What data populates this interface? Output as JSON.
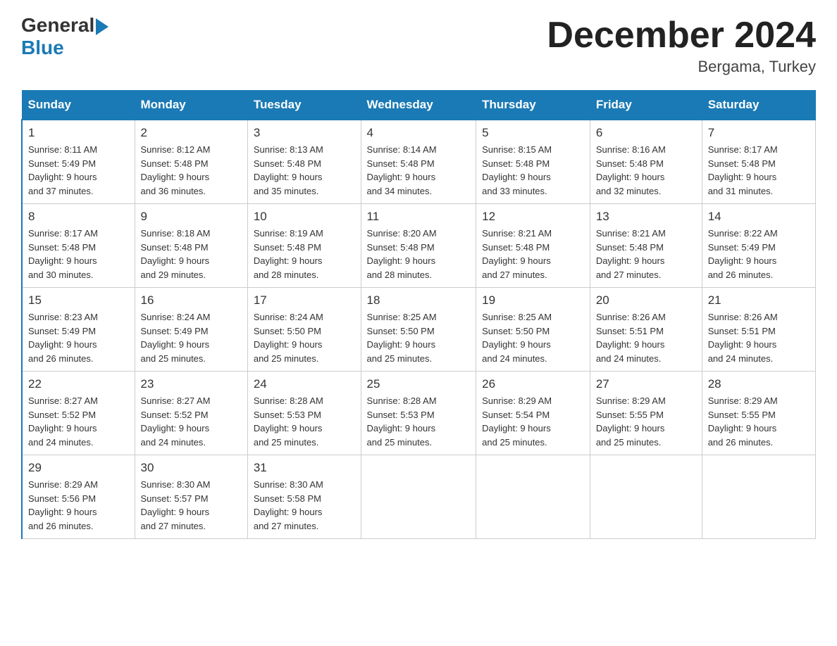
{
  "logo": {
    "general": "General",
    "blue": "Blue"
  },
  "title": "December 2024",
  "location": "Bergama, Turkey",
  "days_of_week": [
    "Sunday",
    "Monday",
    "Tuesday",
    "Wednesday",
    "Thursday",
    "Friday",
    "Saturday"
  ],
  "weeks": [
    [
      {
        "day": "1",
        "sunrise": "8:11 AM",
        "sunset": "5:49 PM",
        "daylight": "9 hours and 37 minutes."
      },
      {
        "day": "2",
        "sunrise": "8:12 AM",
        "sunset": "5:48 PM",
        "daylight": "9 hours and 36 minutes."
      },
      {
        "day": "3",
        "sunrise": "8:13 AM",
        "sunset": "5:48 PM",
        "daylight": "9 hours and 35 minutes."
      },
      {
        "day": "4",
        "sunrise": "8:14 AM",
        "sunset": "5:48 PM",
        "daylight": "9 hours and 34 minutes."
      },
      {
        "day": "5",
        "sunrise": "8:15 AM",
        "sunset": "5:48 PM",
        "daylight": "9 hours and 33 minutes."
      },
      {
        "day": "6",
        "sunrise": "8:16 AM",
        "sunset": "5:48 PM",
        "daylight": "9 hours and 32 minutes."
      },
      {
        "day": "7",
        "sunrise": "8:17 AM",
        "sunset": "5:48 PM",
        "daylight": "9 hours and 31 minutes."
      }
    ],
    [
      {
        "day": "8",
        "sunrise": "8:17 AM",
        "sunset": "5:48 PM",
        "daylight": "9 hours and 30 minutes."
      },
      {
        "day": "9",
        "sunrise": "8:18 AM",
        "sunset": "5:48 PM",
        "daylight": "9 hours and 29 minutes."
      },
      {
        "day": "10",
        "sunrise": "8:19 AM",
        "sunset": "5:48 PM",
        "daylight": "9 hours and 28 minutes."
      },
      {
        "day": "11",
        "sunrise": "8:20 AM",
        "sunset": "5:48 PM",
        "daylight": "9 hours and 28 minutes."
      },
      {
        "day": "12",
        "sunrise": "8:21 AM",
        "sunset": "5:48 PM",
        "daylight": "9 hours and 27 minutes."
      },
      {
        "day": "13",
        "sunrise": "8:21 AM",
        "sunset": "5:48 PM",
        "daylight": "9 hours and 27 minutes."
      },
      {
        "day": "14",
        "sunrise": "8:22 AM",
        "sunset": "5:49 PM",
        "daylight": "9 hours and 26 minutes."
      }
    ],
    [
      {
        "day": "15",
        "sunrise": "8:23 AM",
        "sunset": "5:49 PM",
        "daylight": "9 hours and 26 minutes."
      },
      {
        "day": "16",
        "sunrise": "8:24 AM",
        "sunset": "5:49 PM",
        "daylight": "9 hours and 25 minutes."
      },
      {
        "day": "17",
        "sunrise": "8:24 AM",
        "sunset": "5:50 PM",
        "daylight": "9 hours and 25 minutes."
      },
      {
        "day": "18",
        "sunrise": "8:25 AM",
        "sunset": "5:50 PM",
        "daylight": "9 hours and 25 minutes."
      },
      {
        "day": "19",
        "sunrise": "8:25 AM",
        "sunset": "5:50 PM",
        "daylight": "9 hours and 24 minutes."
      },
      {
        "day": "20",
        "sunrise": "8:26 AM",
        "sunset": "5:51 PM",
        "daylight": "9 hours and 24 minutes."
      },
      {
        "day": "21",
        "sunrise": "8:26 AM",
        "sunset": "5:51 PM",
        "daylight": "9 hours and 24 minutes."
      }
    ],
    [
      {
        "day": "22",
        "sunrise": "8:27 AM",
        "sunset": "5:52 PM",
        "daylight": "9 hours and 24 minutes."
      },
      {
        "day": "23",
        "sunrise": "8:27 AM",
        "sunset": "5:52 PM",
        "daylight": "9 hours and 24 minutes."
      },
      {
        "day": "24",
        "sunrise": "8:28 AM",
        "sunset": "5:53 PM",
        "daylight": "9 hours and 25 minutes."
      },
      {
        "day": "25",
        "sunrise": "8:28 AM",
        "sunset": "5:53 PM",
        "daylight": "9 hours and 25 minutes."
      },
      {
        "day": "26",
        "sunrise": "8:29 AM",
        "sunset": "5:54 PM",
        "daylight": "9 hours and 25 minutes."
      },
      {
        "day": "27",
        "sunrise": "8:29 AM",
        "sunset": "5:55 PM",
        "daylight": "9 hours and 25 minutes."
      },
      {
        "day": "28",
        "sunrise": "8:29 AM",
        "sunset": "5:55 PM",
        "daylight": "9 hours and 26 minutes."
      }
    ],
    [
      {
        "day": "29",
        "sunrise": "8:29 AM",
        "sunset": "5:56 PM",
        "daylight": "9 hours and 26 minutes."
      },
      {
        "day": "30",
        "sunrise": "8:30 AM",
        "sunset": "5:57 PM",
        "daylight": "9 hours and 27 minutes."
      },
      {
        "day": "31",
        "sunrise": "8:30 AM",
        "sunset": "5:58 PM",
        "daylight": "9 hours and 27 minutes."
      },
      null,
      null,
      null,
      null
    ]
  ]
}
